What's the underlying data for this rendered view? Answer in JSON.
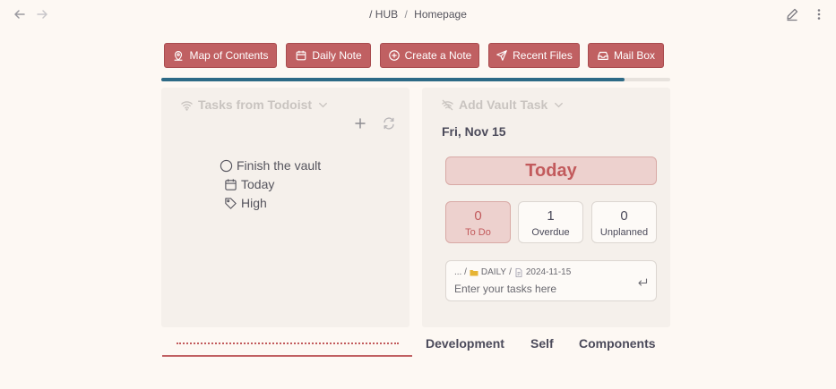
{
  "breadcrumb": {
    "root": "/",
    "parent": "HUB",
    "separator": "/",
    "current": "Homepage"
  },
  "nav": {
    "back_icon": "arrow-left-icon",
    "forward_icon": "arrow-right-icon",
    "edit_icon": "pencil-icon",
    "more_icon": "more-vertical-icon"
  },
  "actions": [
    {
      "label": "Map of Contents",
      "icon": "map-pin-icon"
    },
    {
      "label": "Daily Note",
      "icon": "calendar-icon"
    },
    {
      "label": "Create a Note",
      "icon": "plus-circle-icon"
    },
    {
      "label": "Recent Files",
      "icon": "send-icon"
    },
    {
      "label": "Mail Box",
      "icon": "inbox-icon"
    }
  ],
  "progress": {
    "fraction": 0.91,
    "color": "#2d6a86"
  },
  "todoist": {
    "title": "Tasks from Todoist",
    "task": {
      "name": "Finish the vault",
      "due": "Today",
      "priority": "High"
    }
  },
  "vault": {
    "title": "Add Vault Task",
    "date": "Fri, Nov 15",
    "today_label": "Today",
    "stats": [
      {
        "value": "0",
        "label": "To Do",
        "active": true
      },
      {
        "value": "1",
        "label": "Overdue",
        "active": false
      },
      {
        "value": "0",
        "label": "Unplanned",
        "active": false
      }
    ],
    "input": {
      "path_prefix": "... /",
      "folder": "DAILY",
      "path_sep": "/",
      "file": "2024-11-15",
      "placeholder": "Enter your tasks here"
    }
  },
  "tabs": [
    "Development",
    "Self",
    "Components"
  ],
  "colors": {
    "accent": "#c06062",
    "background": "#fdf8f3",
    "panel": "#f5f0eb",
    "progress": "#2d6a86"
  }
}
